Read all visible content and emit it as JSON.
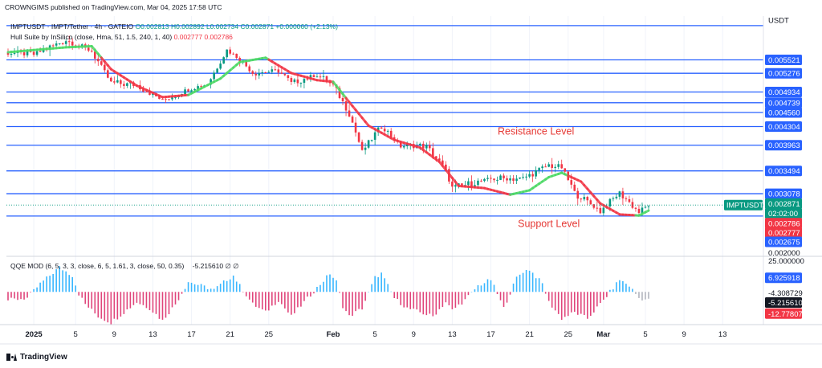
{
  "header": {
    "publisher": "CROWNGIMS published on TradingView.com, Mar 04, 2025 17:58 UTC",
    "currency": "USDT"
  },
  "legend": {
    "symbol": "IMPTUSDT · IMPT/Tether · 4h · GATEIO",
    "ohlc": "O0.002813  H0.002892  L0.002734  C0.002871  +0.000060 (+2.13%)",
    "hull": "Hull Suite by InSilico (close, Hma, 51, 1.5, 240, 1, 40)",
    "hull_values": "0.002777  0.002786",
    "qqe": "QQE MOD (6, 5, 3, 3, close, 6, 5, 1.61, 3, close, 50, 0.35)",
    "qqe_value": "-5.215610  ∅  ∅"
  },
  "brand": "TradingView",
  "chart_data": {
    "type": "candlestick",
    "ylim": [
      0.00195,
      0.00632
    ],
    "levels": [
      0.006146,
      0.005521,
      0.005276,
      0.004934,
      0.004739,
      0.00456,
      0.004304,
      0.003963,
      0.003494,
      0.003078,
      0.00267
    ],
    "price_labels": [
      {
        "text": "USDT",
        "value": 0.00625,
        "style": "title"
      },
      {
        "text": "0.005521",
        "value": 0.005521,
        "style": "level"
      },
      {
        "text": "0.005276",
        "value": 0.005276,
        "style": "level"
      },
      {
        "text": "0.004934",
        "value": 0.004934,
        "style": "level"
      },
      {
        "text": "0.004739",
        "value": 0.004739,
        "style": "level"
      },
      {
        "text": "0.004560",
        "value": 0.00456,
        "style": "level"
      },
      {
        "text": "0.004304",
        "value": 0.004304,
        "style": "level"
      },
      {
        "text": "0.003963",
        "value": 0.003963,
        "style": "level"
      },
      {
        "text": "0.003494",
        "value": 0.003494,
        "style": "level"
      },
      {
        "text": "0.003078",
        "value": 0.003078,
        "style": "level"
      },
      {
        "text": "0.002871",
        "value": 0.002898,
        "style": "current"
      },
      {
        "text": "02:02:00",
        "value": 0.00272,
        "style": "current"
      },
      {
        "text": "0.002786",
        "value": 0.00254,
        "style": "hull"
      },
      {
        "text": "0.002777",
        "value": 0.00237,
        "style": "hull"
      },
      {
        "text": "0.002675",
        "value": 0.0022,
        "style": "level"
      },
      {
        "text": "0.002000",
        "value": 0.002,
        "style": "plain"
      }
    ],
    "current_tag": "IMPTUSDT",
    "current_price": 0.002871,
    "annotations": [
      {
        "text": "Resistance Level",
        "x_index": 164,
        "y": 0.00416
      },
      {
        "text": "Support Level",
        "x_index": 168,
        "y": 0.00247
      }
    ],
    "x_ticks": [
      {
        "label": "2025",
        "index": 8,
        "bold": true
      },
      {
        "label": "5",
        "index": 21
      },
      {
        "label": "9",
        "index": 33
      },
      {
        "label": "13",
        "index": 45
      },
      {
        "label": "17",
        "index": 57
      },
      {
        "label": "21",
        "index": 69
      },
      {
        "label": "25",
        "index": 81
      },
      {
        "label": "Feb",
        "index": 101,
        "bold": true
      },
      {
        "label": "5",
        "index": 114
      },
      {
        "label": "9",
        "index": 126
      },
      {
        "label": "13",
        "index": 138
      },
      {
        "label": "17",
        "index": 150
      },
      {
        "label": "21",
        "index": 162
      },
      {
        "label": "25",
        "index": 174
      },
      {
        "label": "Mar",
        "index": 185,
        "bold": true
      },
      {
        "label": "5",
        "index": 198
      },
      {
        "label": "9",
        "index": 210
      },
      {
        "label": "13",
        "index": 222
      }
    ],
    "price_path": [
      [
        0,
        0.00565
      ],
      [
        8,
        0.00562
      ],
      [
        18,
        0.00588
      ],
      [
        26,
        0.00568
      ],
      [
        32,
        0.0051
      ],
      [
        40,
        0.00506
      ],
      [
        48,
        0.00478
      ],
      [
        56,
        0.00498
      ],
      [
        62,
        0.00508
      ],
      [
        68,
        0.0057
      ],
      [
        72,
        0.00554
      ],
      [
        76,
        0.00528
      ],
      [
        84,
        0.00532
      ],
      [
        88,
        0.0051
      ],
      [
        96,
        0.00525
      ],
      [
        101,
        0.00505
      ],
      [
        106,
        0.00455
      ],
      [
        110,
        0.00385
      ],
      [
        116,
        0.00432
      ],
      [
        122,
        0.00395
      ],
      [
        130,
        0.00395
      ],
      [
        136,
        0.0035
      ],
      [
        138,
        0.00318
      ],
      [
        142,
        0.00324
      ],
      [
        150,
        0.00335
      ],
      [
        160,
        0.00336
      ],
      [
        168,
        0.0036
      ],
      [
        172,
        0.00356
      ],
      [
        176,
        0.0031
      ],
      [
        184,
        0.00276
      ],
      [
        190,
        0.0031
      ],
      [
        196,
        0.00274
      ],
      [
        199,
        0.002871
      ]
    ],
    "hull_path": [
      [
        0,
        0.00566
      ],
      [
        18,
        0.00575
      ],
      [
        26,
        0.00577
      ],
      [
        32,
        0.00535
      ],
      [
        40,
        0.00505
      ],
      [
        48,
        0.00484
      ],
      [
        56,
        0.00488
      ],
      [
        66,
        0.00518
      ],
      [
        72,
        0.00548
      ],
      [
        80,
        0.00556
      ],
      [
        88,
        0.00528
      ],
      [
        96,
        0.00515
      ],
      [
        101,
        0.00512
      ],
      [
        106,
        0.00475
      ],
      [
        112,
        0.00432
      ],
      [
        120,
        0.00406
      ],
      [
        128,
        0.00392
      ],
      [
        134,
        0.00366
      ],
      [
        140,
        0.00322
      ],
      [
        148,
        0.00318
      ],
      [
        156,
        0.00306
      ],
      [
        162,
        0.00314
      ],
      [
        168,
        0.00338
      ],
      [
        172,
        0.00346
      ],
      [
        178,
        0.0033
      ],
      [
        184,
        0.0029
      ],
      [
        190,
        0.0027
      ],
      [
        196,
        0.00268
      ],
      [
        199,
        0.00277
      ]
    ],
    "hull_uptrend_ranges": [
      [
        0,
        28
      ],
      [
        56,
        80
      ],
      [
        101,
        104
      ],
      [
        156,
        173
      ],
      [
        195,
        199
      ]
    ],
    "qqe": {
      "ylim": [
        -16,
        17
      ],
      "price_labels": [
        {
          "text": "25.000000",
          "value": 15.3,
          "style": "plain"
        },
        {
          "text": "6.925918",
          "value": 6.9,
          "style": "blue"
        },
        {
          "text": "-4.308729",
          "value": -0.4,
          "style": "plain"
        },
        {
          "text": "-5.215610",
          "value": -5.2,
          "style": "dark"
        },
        {
          "text": "-12.778074",
          "value": -10.6,
          "style": "red"
        }
      ],
      "path": [
        [
          0,
          -4
        ],
        [
          6,
          -3
        ],
        [
          10,
          4
        ],
        [
          16,
          12
        ],
        [
          20,
          8
        ],
        [
          22,
          -1
        ],
        [
          24,
          -6
        ],
        [
          28,
          -12
        ],
        [
          32,
          -15
        ],
        [
          36,
          -10
        ],
        [
          40,
          -5
        ],
        [
          44,
          -8
        ],
        [
          48,
          -14
        ],
        [
          52,
          -6
        ],
        [
          56,
          5
        ],
        [
          60,
          3
        ],
        [
          64,
          1
        ],
        [
          68,
          6
        ],
        [
          70,
          8
        ],
        [
          72,
          3
        ],
        [
          76,
          -6
        ],
        [
          80,
          -10
        ],
        [
          84,
          -4
        ],
        [
          88,
          -12
        ],
        [
          92,
          -5
        ],
        [
          96,
          2
        ],
        [
          100,
          9
        ],
        [
          102,
          5
        ],
        [
          104,
          -7
        ],
        [
          106,
          -12
        ],
        [
          110,
          -8
        ],
        [
          114,
          7
        ],
        [
          116,
          9
        ],
        [
          120,
          -3
        ],
        [
          124,
          -8
        ],
        [
          128,
          -10
        ],
        [
          132,
          -12
        ],
        [
          136,
          -5
        ],
        [
          138,
          -9
        ],
        [
          142,
          -4
        ],
        [
          146,
          3
        ],
        [
          150,
          6
        ],
        [
          154,
          -8
        ],
        [
          158,
          7
        ],
        [
          160,
          10
        ],
        [
          162,
          11
        ],
        [
          166,
          4
        ],
        [
          168,
          -5
        ],
        [
          172,
          -13
        ],
        [
          176,
          -10
        ],
        [
          180,
          -13
        ],
        [
          184,
          -6
        ],
        [
          186,
          -2
        ],
        [
          190,
          6
        ],
        [
          193,
          3
        ],
        [
          196,
          -3
        ],
        [
          199,
          -4
        ]
      ]
    }
  }
}
